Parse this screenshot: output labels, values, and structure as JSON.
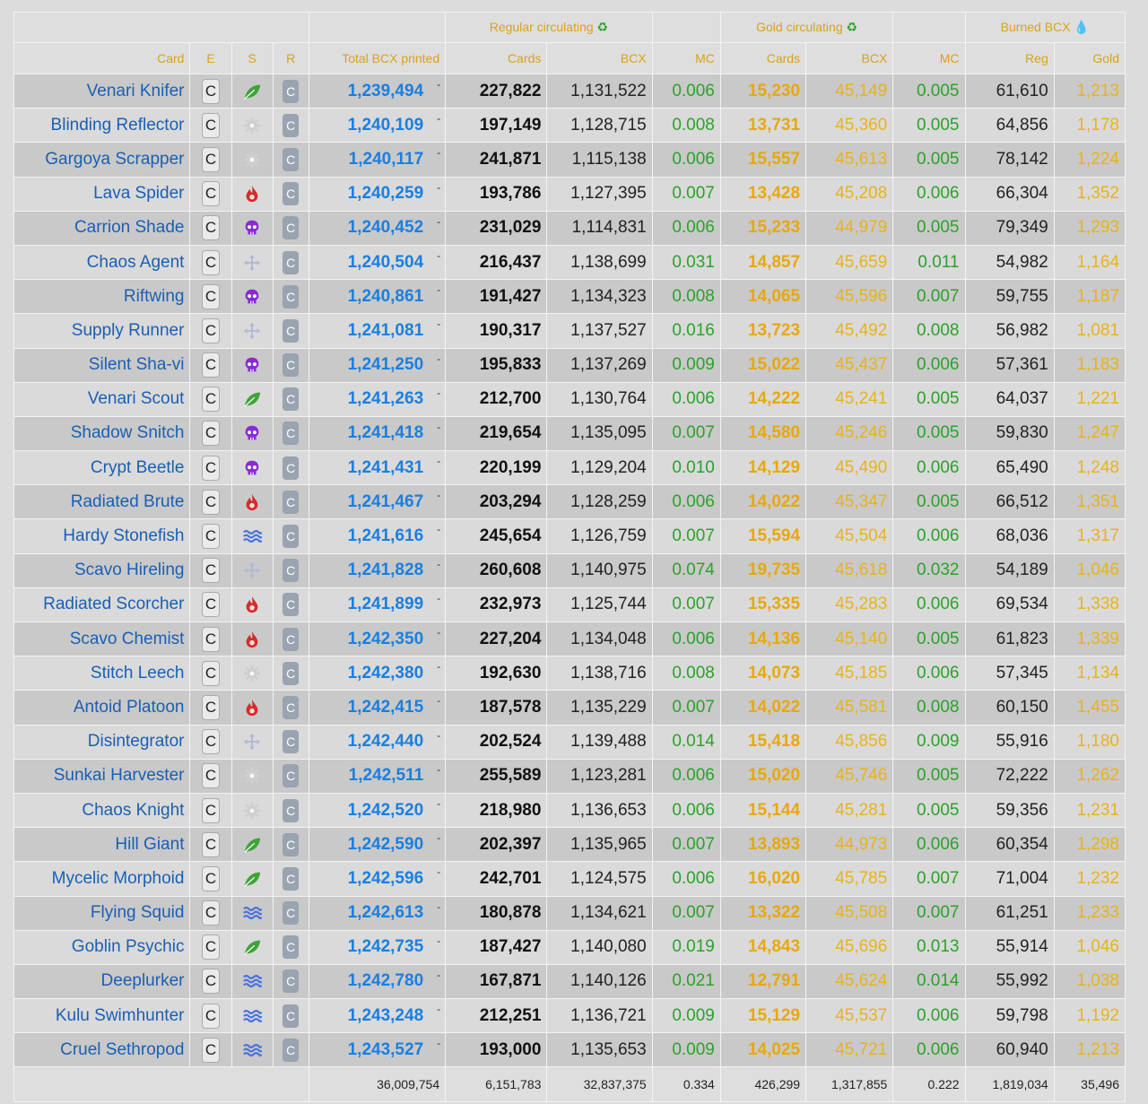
{
  "header": {
    "group_regular": "Regular circulating",
    "group_gold": "Gold circulating",
    "group_burned": "Burned BCX",
    "recycle_symbol": "♻",
    "drop_symbol": "💧",
    "cols": {
      "card": "Card",
      "e": "E",
      "s": "S",
      "r": "R",
      "total": "Total BCX printed",
      "reg_cards": "Cards",
      "reg_bcx": "BCX",
      "reg_mc": "MC",
      "gold_cards": "Cards",
      "gold_bcx": "BCX",
      "gold_mc": "MC",
      "burn_reg": "Reg",
      "burn_gold": "Gold"
    }
  },
  "colors": {
    "life": "#3fa33a",
    "neutral": "#cfcfcf",
    "fire": "#d62b2b",
    "death": "#8a2ad6",
    "dragon": "#aeb8d6",
    "water": "#4a72d9",
    "link": "#1a5fb4",
    "gold": "#e8a80c",
    "mc": "#2aa22a"
  },
  "rows": [
    {
      "name": "Venari Knifer",
      "e": "C",
      "s": "life",
      "r": "C",
      "total": "1,239,494",
      "dash": "-",
      "rc": "227,822",
      "rb": "1,131,522",
      "rmc": "0.006",
      "gc": "15,230",
      "gb": "45,149",
      "gmc": "0.005",
      "br": "61,610",
      "bg": "1,213"
    },
    {
      "name": "Blinding Reflector",
      "e": "C",
      "s": "neutral",
      "r": "C",
      "total": "1,240,109",
      "dash": "-",
      "rc": "197,149",
      "rb": "1,128,715",
      "rmc": "0.008",
      "gc": "13,731",
      "gb": "45,360",
      "gmc": "0.005",
      "br": "64,856",
      "bg": "1,178"
    },
    {
      "name": "Gargoya Scrapper",
      "e": "C",
      "s": "neutral",
      "r": "C",
      "total": "1,240,117",
      "dash": "-",
      "rc": "241,871",
      "rb": "1,115,138",
      "rmc": "0.006",
      "gc": "15,557",
      "gb": "45,613",
      "gmc": "0.005",
      "br": "78,142",
      "bg": "1,224"
    },
    {
      "name": "Lava Spider",
      "e": "C",
      "s": "fire",
      "r": "C",
      "total": "1,240,259",
      "dash": "-",
      "rc": "193,786",
      "rb": "1,127,395",
      "rmc": "0.007",
      "gc": "13,428",
      "gb": "45,208",
      "gmc": "0.006",
      "br": "66,304",
      "bg": "1,352"
    },
    {
      "name": "Carrion Shade",
      "e": "C",
      "s": "death",
      "r": "C",
      "total": "1,240,452",
      "dash": "-",
      "rc": "231,029",
      "rb": "1,114,831",
      "rmc": "0.006",
      "gc": "15,233",
      "gb": "44,979",
      "gmc": "0.005",
      "br": "79,349",
      "bg": "1,293"
    },
    {
      "name": "Chaos Agent",
      "e": "C",
      "s": "dragon",
      "r": "C",
      "total": "1,240,504",
      "dash": "-",
      "rc": "216,437",
      "rb": "1,138,699",
      "rmc": "0.031",
      "gc": "14,857",
      "gb": "45,659",
      "gmc": "0.011",
      "br": "54,982",
      "bg": "1,164"
    },
    {
      "name": "Riftwing",
      "e": "C",
      "s": "death",
      "r": "C",
      "total": "1,240,861",
      "dash": "-",
      "rc": "191,427",
      "rb": "1,134,323",
      "rmc": "0.008",
      "gc": "14,065",
      "gb": "45,596",
      "gmc": "0.007",
      "br": "59,755",
      "bg": "1,187"
    },
    {
      "name": "Supply Runner",
      "e": "C",
      "s": "dragon",
      "r": "C",
      "total": "1,241,081",
      "dash": "-",
      "rc": "190,317",
      "rb": "1,137,527",
      "rmc": "0.016",
      "gc": "13,723",
      "gb": "45,492",
      "gmc": "0.008",
      "br": "56,982",
      "bg": "1,081"
    },
    {
      "name": "Silent Sha-vi",
      "e": "C",
      "s": "death",
      "r": "C",
      "total": "1,241,250",
      "dash": "-",
      "rc": "195,833",
      "rb": "1,137,269",
      "rmc": "0.009",
      "gc": "15,022",
      "gb": "45,437",
      "gmc": "0.006",
      "br": "57,361",
      "bg": "1,183"
    },
    {
      "name": "Venari Scout",
      "e": "C",
      "s": "life",
      "r": "C",
      "total": "1,241,263",
      "dash": "-",
      "rc": "212,700",
      "rb": "1,130,764",
      "rmc": "0.006",
      "gc": "14,222",
      "gb": "45,241",
      "gmc": "0.005",
      "br": "64,037",
      "bg": "1,221"
    },
    {
      "name": "Shadow Snitch",
      "e": "C",
      "s": "death",
      "r": "C",
      "total": "1,241,418",
      "dash": "-",
      "rc": "219,654",
      "rb": "1,135,095",
      "rmc": "0.007",
      "gc": "14,580",
      "gb": "45,246",
      "gmc": "0.005",
      "br": "59,830",
      "bg": "1,247"
    },
    {
      "name": "Crypt Beetle",
      "e": "C",
      "s": "death",
      "r": "C",
      "total": "1,241,431",
      "dash": "-",
      "rc": "220,199",
      "rb": "1,129,204",
      "rmc": "0.010",
      "gc": "14,129",
      "gb": "45,490",
      "gmc": "0.006",
      "br": "65,490",
      "bg": "1,248"
    },
    {
      "name": "Radiated Brute",
      "e": "C",
      "s": "fire",
      "r": "C",
      "total": "1,241,467",
      "dash": "-",
      "rc": "203,294",
      "rb": "1,128,259",
      "rmc": "0.006",
      "gc": "14,022",
      "gb": "45,347",
      "gmc": "0.005",
      "br": "66,512",
      "bg": "1,351"
    },
    {
      "name": "Hardy Stonefish",
      "e": "C",
      "s": "water",
      "r": "C",
      "total": "1,241,616",
      "dash": "-",
      "rc": "245,654",
      "rb": "1,126,759",
      "rmc": "0.007",
      "gc": "15,594",
      "gb": "45,504",
      "gmc": "0.006",
      "br": "68,036",
      "bg": "1,317"
    },
    {
      "name": "Scavo Hireling",
      "e": "C",
      "s": "dragon",
      "r": "C",
      "total": "1,241,828",
      "dash": "-",
      "rc": "260,608",
      "rb": "1,140,975",
      "rmc": "0.074",
      "gc": "19,735",
      "gb": "45,618",
      "gmc": "0.032",
      "br": "54,189",
      "bg": "1,046"
    },
    {
      "name": "Radiated Scorcher",
      "e": "C",
      "s": "fire",
      "r": "C",
      "total": "1,241,899",
      "dash": "-",
      "rc": "232,973",
      "rb": "1,125,744",
      "rmc": "0.007",
      "gc": "15,335",
      "gb": "45,283",
      "gmc": "0.006",
      "br": "69,534",
      "bg": "1,338"
    },
    {
      "name": "Scavo Chemist",
      "e": "C",
      "s": "fire",
      "r": "C",
      "total": "1,242,350",
      "dash": "-",
      "rc": "227,204",
      "rb": "1,134,048",
      "rmc": "0.006",
      "gc": "14,136",
      "gb": "45,140",
      "gmc": "0.005",
      "br": "61,823",
      "bg": "1,339"
    },
    {
      "name": "Stitch Leech",
      "e": "C",
      "s": "neutral",
      "r": "C",
      "total": "1,242,380",
      "dash": "-",
      "rc": "192,630",
      "rb": "1,138,716",
      "rmc": "0.008",
      "gc": "14,073",
      "gb": "45,185",
      "gmc": "0.006",
      "br": "57,345",
      "bg": "1,134"
    },
    {
      "name": "Antoid Platoon",
      "e": "C",
      "s": "fire",
      "r": "C",
      "total": "1,242,415",
      "dash": "-",
      "rc": "187,578",
      "rb": "1,135,229",
      "rmc": "0.007",
      "gc": "14,022",
      "gb": "45,581",
      "gmc": "0.008",
      "br": "60,150",
      "bg": "1,455"
    },
    {
      "name": "Disintegrator",
      "e": "C",
      "s": "dragon",
      "r": "C",
      "total": "1,242,440",
      "dash": "-",
      "rc": "202,524",
      "rb": "1,139,488",
      "rmc": "0.014",
      "gc": "15,418",
      "gb": "45,856",
      "gmc": "0.009",
      "br": "55,916",
      "bg": "1,180"
    },
    {
      "name": "Sunkai Harvester",
      "e": "C",
      "s": "neutral",
      "r": "C",
      "total": "1,242,511",
      "dash": "-",
      "rc": "255,589",
      "rb": "1,123,281",
      "rmc": "0.006",
      "gc": "15,020",
      "gb": "45,746",
      "gmc": "0.005",
      "br": "72,222",
      "bg": "1,262"
    },
    {
      "name": "Chaos Knight",
      "e": "C",
      "s": "neutral",
      "r": "C",
      "total": "1,242,520",
      "dash": "-",
      "rc": "218,980",
      "rb": "1,136,653",
      "rmc": "0.006",
      "gc": "15,144",
      "gb": "45,281",
      "gmc": "0.005",
      "br": "59,356",
      "bg": "1,231"
    },
    {
      "name": "Hill Giant",
      "e": "C",
      "s": "life",
      "r": "C",
      "total": "1,242,590",
      "dash": "-",
      "rc": "202,397",
      "rb": "1,135,965",
      "rmc": "0.007",
      "gc": "13,893",
      "gb": "44,973",
      "gmc": "0.006",
      "br": "60,354",
      "bg": "1,298"
    },
    {
      "name": "Mycelic Morphoid",
      "e": "C",
      "s": "life",
      "r": "C",
      "total": "1,242,596",
      "dash": "-",
      "rc": "242,701",
      "rb": "1,124,575",
      "rmc": "0.006",
      "gc": "16,020",
      "gb": "45,785",
      "gmc": "0.007",
      "br": "71,004",
      "bg": "1,232"
    },
    {
      "name": "Flying Squid",
      "e": "C",
      "s": "water",
      "r": "C",
      "total": "1,242,613",
      "dash": "-",
      "rc": "180,878",
      "rb": "1,134,621",
      "rmc": "0.007",
      "gc": "13,322",
      "gb": "45,508",
      "gmc": "0.007",
      "br": "61,251",
      "bg": "1,233"
    },
    {
      "name": "Goblin Psychic",
      "e": "C",
      "s": "life",
      "r": "C",
      "total": "1,242,735",
      "dash": "-",
      "rc": "187,427",
      "rb": "1,140,080",
      "rmc": "0.019",
      "gc": "14,843",
      "gb": "45,696",
      "gmc": "0.013",
      "br": "55,914",
      "bg": "1,046"
    },
    {
      "name": "Deeplurker",
      "e": "C",
      "s": "water",
      "r": "C",
      "total": "1,242,780",
      "dash": "-",
      "rc": "167,871",
      "rb": "1,140,126",
      "rmc": "0.021",
      "gc": "12,791",
      "gb": "45,624",
      "gmc": "0.014",
      "br": "55,992",
      "bg": "1,038"
    },
    {
      "name": "Kulu Swimhunter",
      "e": "C",
      "s": "water",
      "r": "C",
      "total": "1,243,248",
      "dash": "-",
      "rc": "212,251",
      "rb": "1,136,721",
      "rmc": "0.009",
      "gc": "15,129",
      "gb": "45,537",
      "gmc": "0.006",
      "br": "59,798",
      "bg": "1,192"
    },
    {
      "name": "Cruel Sethropod",
      "e": "C",
      "s": "water",
      "r": "C",
      "total": "1,243,527",
      "dash": "-",
      "rc": "193,000",
      "rb": "1,135,653",
      "rmc": "0.009",
      "gc": "14,025",
      "gb": "45,721",
      "gmc": "0.006",
      "br": "60,940",
      "bg": "1,213"
    }
  ],
  "totals": {
    "total": "36,009,754",
    "rc": "6,151,783",
    "rb": "32,837,375",
    "rmc": "0.334",
    "gc": "426,299",
    "gb": "1,317,855",
    "gmc": "0.222",
    "br": "1,819,034",
    "bg": "35,496"
  }
}
